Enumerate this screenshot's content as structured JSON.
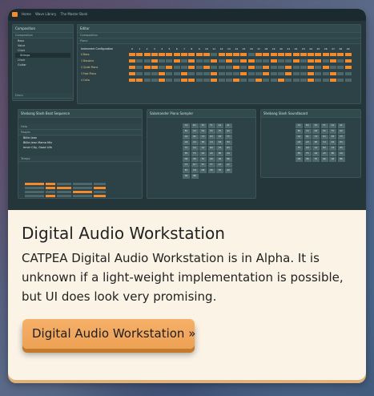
{
  "screenshot": {
    "nav": [
      "Home",
      "Wave Library",
      "The Master Bank"
    ],
    "composition": {
      "title": "Composition",
      "section": "Composition",
      "items": [
        "Bass",
        "Voice",
        "Choir",
        "Strings",
        "Choir",
        "Guitar"
      ],
      "selected_index": 3,
      "footer": "Drum"
    },
    "editor": {
      "title": "Editor",
      "section": "Composition",
      "subsection": "Piano",
      "header_label": "Instrument Configuration",
      "columns": [
        "0",
        "1",
        "2",
        "3",
        "4",
        "5",
        "6",
        "7",
        "8",
        "9",
        "10",
        "11",
        "12",
        "13",
        "14",
        "15",
        "16",
        "17",
        "18",
        "19",
        "20",
        "21",
        "22",
        "23",
        "24",
        "25",
        "26",
        "27",
        "28",
        "29"
      ],
      "instruments": [
        "0 Bass",
        "1 Bassline",
        "2 Quiet Piano",
        "3 Fast Piano",
        "4 Cello"
      ]
    },
    "sequence": {
      "title": "Shebang Slash Beat Sequence",
      "help": "Help",
      "people_label": "People",
      "people": [
        "Billie Jean",
        "Billie Jean Mama Mix",
        "Inner City, Good Life"
      ],
      "tempo": "Tempo"
    },
    "sampler": {
      "title": "Salamander Piano Sampler",
      "pads": [
        "C1",
        "D1",
        "E1",
        "F1",
        "G1",
        "A1",
        "B1",
        "C2",
        "D2",
        "E2",
        "F2",
        "G2",
        "A2",
        "B2",
        "C3",
        "D3",
        "E3",
        "F3",
        "G3",
        "A3",
        "B3",
        "C4",
        "D4",
        "E4",
        "F4",
        "G4",
        "A4",
        "B4",
        "C5",
        "D5",
        "E5",
        "F5",
        "G5",
        "A5",
        "B5",
        "C6",
        "D6",
        "E6",
        "F6",
        "G6",
        "A6",
        "B6",
        "C7",
        "D7",
        "E7",
        "F7",
        "G7",
        "A7",
        "B7",
        "C8",
        "D8",
        "E8",
        "F8",
        "G8",
        "A8",
        "B8"
      ]
    },
    "soundboard": {
      "title": "Shebang Slash Soundboard",
      "pads": [
        "C1",
        "D1",
        "E1",
        "F1",
        "G1",
        "A1",
        "B1",
        "C2",
        "D2",
        "E2",
        "F2",
        "G2",
        "A2",
        "B2",
        "C3",
        "D3",
        "E3",
        "F3",
        "G3",
        "A3",
        "B3",
        "C4",
        "D4",
        "E4",
        "F4",
        "G4",
        "A4",
        "B4",
        "C5",
        "D5",
        "E5",
        "F5",
        "G5",
        "A5",
        "B5",
        "C6",
        "D6",
        "E6",
        "F6",
        "G6",
        "A6",
        "B6"
      ]
    },
    "accent_color": "#f28a2e"
  },
  "card": {
    "title": "Digital Audio Workstation",
    "description": "CATPEA Digital Audio Workstation is in Alpha. It is unknown if a light-weight implementation is possible, but UI does look very promising.",
    "button_label": "Digital Audio Workstation »"
  }
}
